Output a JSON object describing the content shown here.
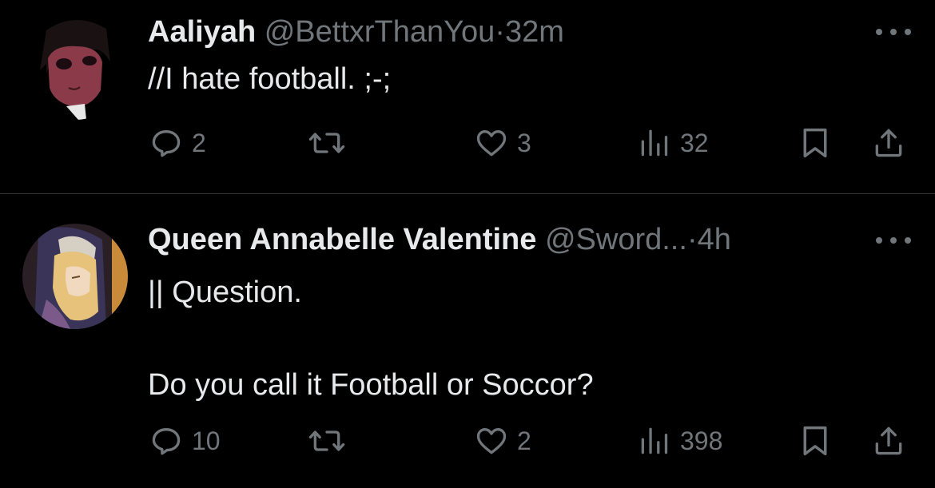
{
  "colors": {
    "background": "#000000",
    "primary_text": "#e7e9ea",
    "secondary_text": "#71767b",
    "divider": "#2f3336"
  },
  "tweets": [
    {
      "display_name": "Aaliyah",
      "handle": "@BettxrThanYou",
      "separator": "·",
      "time": "32m",
      "text": "//I hate football. ;-;",
      "replies": "2",
      "retweets": "",
      "likes": "3",
      "views": "32"
    },
    {
      "display_name": "Queen Annabelle Valentine",
      "handle": "@Sword...",
      "separator": "·",
      "time": "4h",
      "text": "|| Question.\n\nDo you call it Football or Soccor?",
      "replies": "10",
      "retweets": "",
      "likes": "2",
      "views": "398"
    }
  ],
  "icons": {
    "more": "more-horizontal-icon",
    "reply": "reply-bubble-icon",
    "retweet": "retweet-icon",
    "like": "heart-icon",
    "views": "views-bar-chart-icon",
    "bookmark": "bookmark-icon",
    "share": "share-upload-icon"
  }
}
